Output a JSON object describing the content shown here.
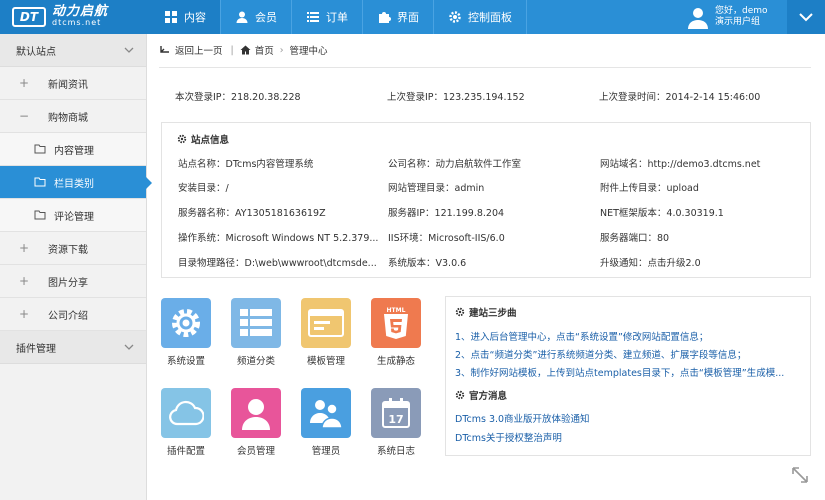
{
  "brand": {
    "mark": "DT",
    "title": "动力启航",
    "sub": "dtcms.net"
  },
  "nav": [
    {
      "label": "内容",
      "icon": "grid-icon",
      "active": true
    },
    {
      "label": "会员",
      "icon": "user-icon"
    },
    {
      "label": "订单",
      "icon": "list-icon"
    },
    {
      "label": "界面",
      "icon": "puzzle-icon"
    },
    {
      "label": "控制面板",
      "icon": "gear-icon"
    }
  ],
  "user": {
    "greeting": "您好，demo",
    "role": "演示用户组"
  },
  "sidebar": {
    "group1": "默认站点",
    "items": [
      {
        "label": "新闻资讯",
        "sign": "+"
      },
      {
        "label": "购物商城",
        "sign": "−"
      },
      {
        "label": "内容管理",
        "sub": true
      },
      {
        "label": "栏目类别",
        "sub": true,
        "active": true
      },
      {
        "label": "评论管理",
        "sub": true
      },
      {
        "label": "资源下载",
        "sign": "+"
      },
      {
        "label": "图片分享",
        "sign": "+"
      },
      {
        "label": "公司介绍",
        "sign": "+"
      }
    ],
    "group2": "插件管理"
  },
  "breadcrumb": {
    "back": "返回上一页",
    "home": "首页",
    "current": "管理中心"
  },
  "login": {
    "this_ip": "本次登录IP：218.20.38.228",
    "last_ip": "上次登录IP：123.235.194.152",
    "last_time": "上次登录时间：2014-2-14 15:46:00"
  },
  "site_info": {
    "title": "站点信息",
    "rows": [
      [
        "站点名称：DTcms内容管理系统",
        "公司名称：动力启航软件工作室",
        "网站域名：http://demo3.dtcms.net"
      ],
      [
        "安装目录：/",
        "网站管理目录：admin",
        "附件上传目录：upload"
      ],
      [
        "服务器名称：AY130518163619Z",
        "服务器IP：121.199.8.204",
        "NET框架版本：4.0.30319.1"
      ],
      [
        "操作系统：Microsoft Windows NT 5.2.379...",
        "IIS环境：Microsoft-IIS/6.0",
        "服务器端口：80"
      ],
      [
        "目录物理路径：D:\\web\\wwwroot\\dtcmsde...",
        "系统版本：V3.0.6",
        "升级通知：点击升级2.0"
      ]
    ]
  },
  "tiles": [
    {
      "label": "系统设置",
      "color": "#6aaee8",
      "icon": "settings-gear-icon"
    },
    {
      "label": "频道分类",
      "color": "#6aaee8",
      "icon": "channel-list-icon"
    },
    {
      "label": "模板管理",
      "color": "#f0c670",
      "icon": "template-icon"
    },
    {
      "label": "生成静态",
      "color": "#ef7a4f",
      "icon": "html5-icon"
    },
    {
      "label": "插件配置",
      "color": "#7ec1e8",
      "icon": "cloud-icon"
    },
    {
      "label": "会员管理",
      "color": "#e8559a",
      "icon": "member-icon"
    },
    {
      "label": "管理员",
      "color": "#4a9fe0",
      "icon": "admin-group-icon"
    },
    {
      "label": "系统日志",
      "color": "#8a9bb8",
      "icon": "calendar-icon"
    }
  ],
  "guide": {
    "title": "建站三步曲",
    "steps": [
      "1、进入后台管理中心，点击“系统设置”修改网站配置信息；",
      "2、点击“频道分类”进行系统频道分类、建立频道、扩展字段等信息；",
      "3、制作好网站模板，上传到站点templates目录下，点击“模板管理”生成模..."
    ]
  },
  "news": {
    "title": "官方消息",
    "items": [
      "DTcms 3.0商业版开放体验通知",
      "DTcms关于授权整治声明"
    ]
  },
  "colors": {
    "primary": "#2a8fd6",
    "primary_dark": "#1d7fc6",
    "link": "#1a5fa8"
  }
}
